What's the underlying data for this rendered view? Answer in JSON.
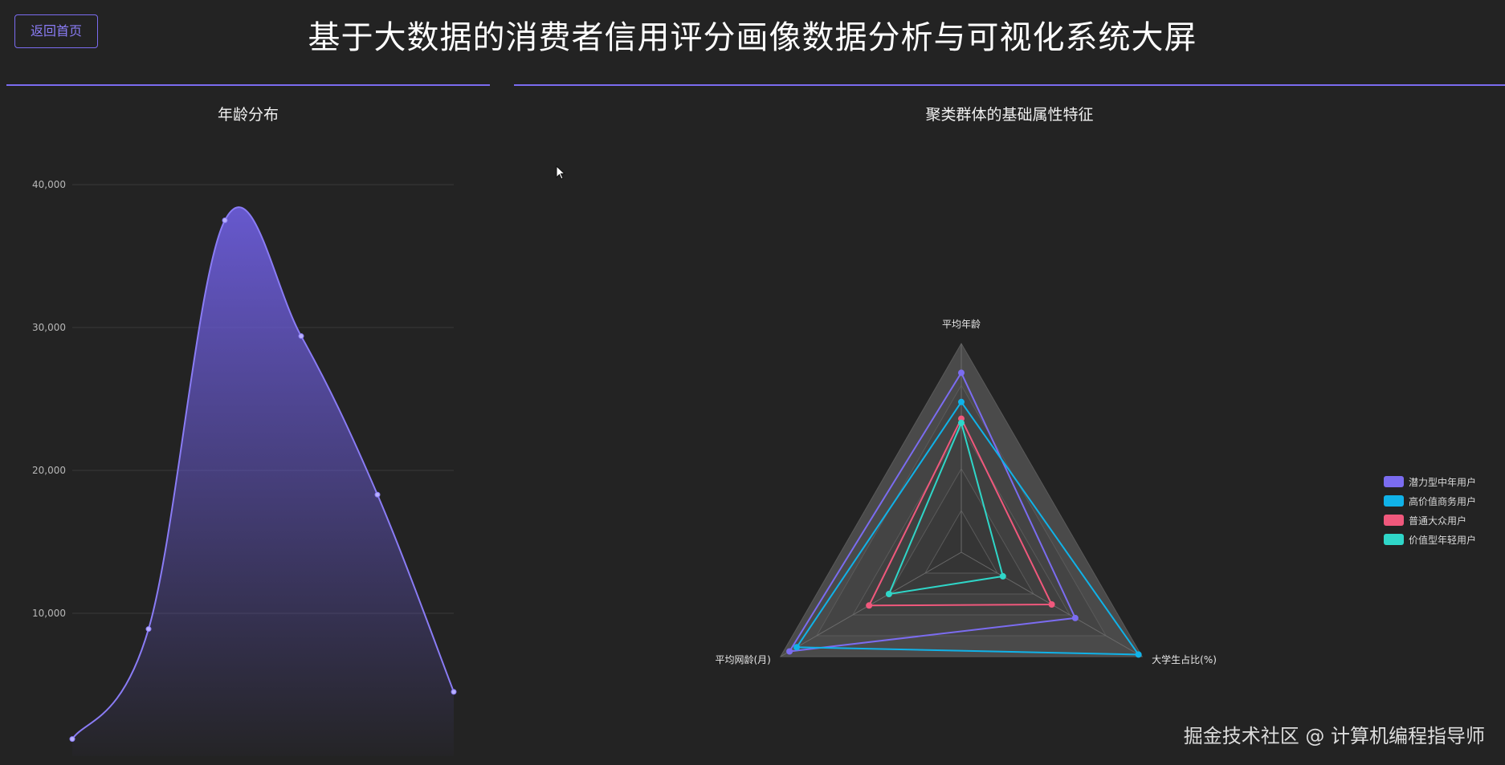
{
  "header": {
    "back_label": "返回首页",
    "title": "基于大数据的消费者信用评分画像数据分析与可视化系统大屏"
  },
  "left_panel": {
    "title": "年龄分布"
  },
  "right_panel": {
    "title": "聚类群体的基础属性特征"
  },
  "watermark": "掘金技术社区 @ 计算机编程指导师",
  "colors": {
    "accent": "#7b6cf0",
    "background": "#232323"
  },
  "chart_data": [
    {
      "type": "area",
      "title": "年龄分布",
      "smooth": true,
      "y_ticks": [
        "10,000",
        "20,000",
        "30,000",
        "40,000"
      ],
      "ylim": [
        0,
        40000
      ],
      "grid": true,
      "x_labels": [],
      "values": [
        1200,
        8900,
        37500,
        29400,
        18300,
        4500
      ],
      "color": "#7b6cf0"
    },
    {
      "type": "radar",
      "title": "聚类群体的基础属性特征",
      "indicators": [
        "平均年龄",
        "大学生占比(%)",
        "平均网龄(月)"
      ],
      "series": [
        {
          "name": "潜力型中年用户",
          "values": [
            0.86,
            0.63,
            0.95
          ],
          "color": "#7b6cf0"
        },
        {
          "name": "高价值商务用户",
          "values": [
            0.72,
            0.98,
            0.91
          ],
          "color": "#10b2e8"
        },
        {
          "name": "普通大众用户",
          "values": [
            0.64,
            0.5,
            0.51
          ],
          "color": "#f0587c"
        },
        {
          "name": "价值型年轻用户",
          "values": [
            0.62,
            0.23,
            0.4
          ],
          "color": "#2fd6c8"
        }
      ],
      "legend_position": "right"
    }
  ]
}
